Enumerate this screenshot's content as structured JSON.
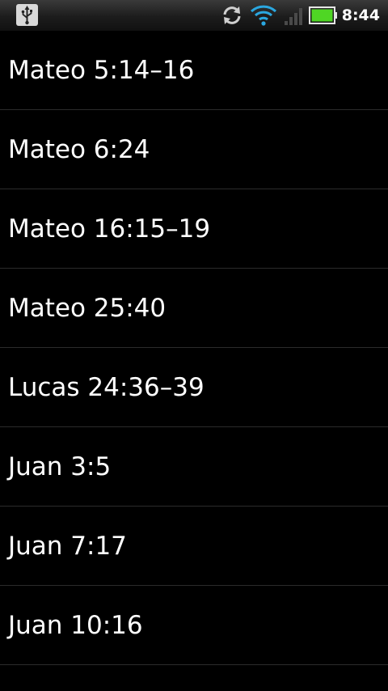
{
  "status_bar": {
    "time": "8:44",
    "icons": {
      "usb": "usb-icon",
      "sync": "sync-icon",
      "wifi": "wifi-icon",
      "signal": "signal-icon",
      "battery": "battery-icon"
    },
    "colors": {
      "wifi": "#2aa7e0",
      "battery_fill": "#4fd624"
    }
  },
  "verses": [
    {
      "label": "Mateo 5:14–16"
    },
    {
      "label": "Mateo 6:24"
    },
    {
      "label": "Mateo 16:15–19"
    },
    {
      "label": "Mateo 25:40"
    },
    {
      "label": "Lucas 24:36–39"
    },
    {
      "label": "Juan 3:5"
    },
    {
      "label": "Juan 7:17"
    },
    {
      "label": "Juan 10:16"
    }
  ]
}
